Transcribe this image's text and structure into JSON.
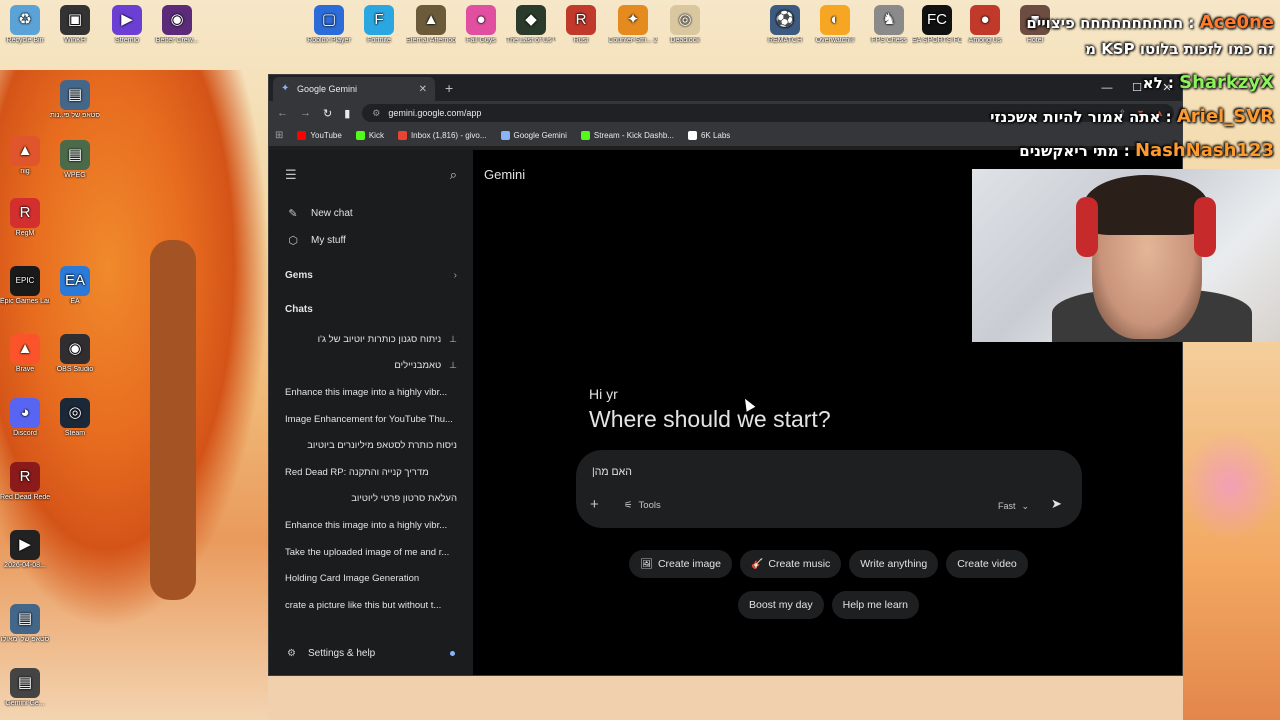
{
  "desktop": {
    "icons": [
      {
        "label": "Recycle Bin",
        "color": "#5ba3d6",
        "glyph": "♻"
      },
      {
        "label": "WinKH",
        "color": "#333333",
        "glyph": "▣"
      },
      {
        "label": "Stremio",
        "color": "#6b3fd4",
        "glyph": "▶"
      },
      {
        "label": "Better Crew...",
        "color": "#5b2b7a",
        "glyph": "◉"
      },
      {
        "label": "Roblox Player",
        "color": "#2c6cd8",
        "glyph": "▢"
      },
      {
        "label": "Fortnite",
        "color": "#2aa7e0",
        "glyph": "F"
      },
      {
        "label": "Eternal Afternoon",
        "color": "#6b5b3b",
        "glyph": "▲"
      },
      {
        "label": "Fall Guys",
        "color": "#e04fa0",
        "glyph": "●"
      },
      {
        "label": "The Last of Us™ Part I...",
        "color": "#2b3b2b",
        "glyph": "◆"
      },
      {
        "label": "Rust",
        "color": "#c0392b",
        "glyph": "R"
      },
      {
        "label": "Counter-Stri... 2",
        "color": "#e58a1f",
        "glyph": "✦"
      },
      {
        "label": "Deadlock",
        "color": "#d9c7a0",
        "glyph": "◎"
      },
      {
        "label": "REMATCH",
        "color": "#3d5a80",
        "glyph": "⚽"
      },
      {
        "label": "Overwatch®",
        "color": "#f6a623",
        "glyph": "◐"
      },
      {
        "label": "FPS Chess",
        "color": "#8a8a8a",
        "glyph": "♞"
      },
      {
        "label": "EA SPORTS FC 26",
        "color": "#111111",
        "glyph": "FC"
      },
      {
        "label": "Among Us",
        "color": "#c0392b",
        "glyph": "●"
      },
      {
        "label": "Hotel",
        "color": "#6d4c41",
        "glyph": "■"
      },
      {
        "label": "סטאפ של פי..נות",
        "color": "#446688",
        "glyph": "▤"
      },
      {
        "label": "nig",
        "color": "#e0552b",
        "glyph": "▲"
      },
      {
        "label": "WPEG",
        "color": "#4a6a4a",
        "glyph": "▤"
      },
      {
        "label": "RegM",
        "color": "#d32f2f",
        "glyph": "R"
      },
      {
        "label": "Epic Games Launcher",
        "color": "#1a1a1a",
        "glyph": "EPIC"
      },
      {
        "label": "EA",
        "color": "#2b7ad8",
        "glyph": "EA"
      },
      {
        "label": "Brave",
        "color": "#fb542b",
        "glyph": "▲"
      },
      {
        "label": "OBS Studio",
        "color": "#302e31",
        "glyph": "◉"
      },
      {
        "label": "Discord",
        "color": "#5865f2",
        "glyph": "◕"
      },
      {
        "label": "Steam",
        "color": "#1b2838",
        "glyph": "◎"
      },
      {
        "label": "Red Dead Redempti...",
        "color": "#8b1a1a",
        "glyph": "R"
      },
      {
        "label": "2026-04-08...",
        "color": "#222222",
        "glyph": "▶"
      },
      {
        "label": "סטאפ של 'מאולו",
        "color": "#446688",
        "glyph": "▤"
      },
      {
        "label": "Gemini Ge...",
        "color": "#444444",
        "glyph": "▤"
      }
    ]
  },
  "stream_chat": [
    {
      "user": "Ace0ne",
      "message": "חחחחחחחחחח פיצויים",
      "user_color": "#ff7b2e"
    },
    {
      "user": "",
      "message": "זה כמו לזכות בלוטו KSP מ",
      "user_color": "#ffffff"
    },
    {
      "user": "SharkzyX",
      "message": "לא",
      "user_color": "#8cf15a"
    },
    {
      "user": "Ariel_SVR",
      "message": "אתה אמור להיות אשכנזי",
      "user_color": "#ff9b2e"
    },
    {
      "user": "NashNash123",
      "message": "מתי ריאקשנים",
      "user_color": "#ff9b2e"
    }
  ],
  "browser": {
    "tab_title": "Google Gemini",
    "tab_close": "✕",
    "new_tab": "+",
    "window_controls": {
      "minimize": "—",
      "maximize": "☐",
      "close": "✕"
    },
    "nav": {
      "back": "←",
      "forward": "→",
      "reload": "↻"
    },
    "url": "gemini.google.com/app",
    "bookmarks": [
      {
        "label": "YouTube",
        "color": "#ff0000"
      },
      {
        "label": "Kick",
        "color": "#53fc18"
      },
      {
        "label": "Inbox (1,816) - givo...",
        "color": "#ea4335"
      },
      {
        "label": "Google Gemini",
        "color": "#8ab4f8"
      },
      {
        "label": "Stream - Kick Dashb...",
        "color": "#53fc18"
      },
      {
        "label": "6K Labs",
        "color": "#ffffff"
      }
    ]
  },
  "gemini": {
    "brand": "Gemini",
    "sidebar": {
      "new_chat": "New chat",
      "my_stuff": "My stuff",
      "gems": "Gems",
      "chats_heading": "Chats",
      "chats": [
        {
          "title": "ניתוח סגנון כותרות יוטיוב של ג'ו",
          "rtl": true,
          "pinned": true
        },
        {
          "title": "טאמבניילים",
          "rtl": true,
          "pinned": true
        },
        {
          "title": "Enhance this image into a highly vibr...",
          "rtl": false,
          "pinned": false
        },
        {
          "title": "Image Enhancement for YouTube Thu...",
          "rtl": false,
          "pinned": false
        },
        {
          "title": "ניסוח כותרת לסטאפ מיליונרים ביוטיוב",
          "rtl": true,
          "pinned": false
        },
        {
          "title": "Red Dead RP: מדריך קנייה והתקנה",
          "rtl": false,
          "pinned": false
        },
        {
          "title": "העלאת סרטון פרטי ליוטיוב",
          "rtl": true,
          "pinned": false
        },
        {
          "title": "Enhance this image into a highly vibr...",
          "rtl": false,
          "pinned": false
        },
        {
          "title": "Take the uploaded image of me and r...",
          "rtl": false,
          "pinned": false
        },
        {
          "title": "Holding Card Image Generation",
          "rtl": false,
          "pinned": false
        },
        {
          "title": "crate a picture like this but without t...",
          "rtl": false,
          "pinned": false
        }
      ],
      "settings": "Settings & help"
    },
    "greeting": "Hi yr",
    "headline": "Where should we start?",
    "composer": {
      "value": "האם מה|",
      "tools_label": "Tools",
      "mode_label": "Fast"
    },
    "chips_row1": [
      {
        "label": "Create image",
        "icon": "🖼"
      },
      {
        "label": "Create music",
        "icon": "🎸"
      },
      {
        "label": "Write anything",
        "icon": ""
      },
      {
        "label": "Create video",
        "icon": ""
      }
    ],
    "chips_row2": [
      {
        "label": "Boost my day",
        "icon": ""
      },
      {
        "label": "Help me learn",
        "icon": ""
      }
    ]
  }
}
